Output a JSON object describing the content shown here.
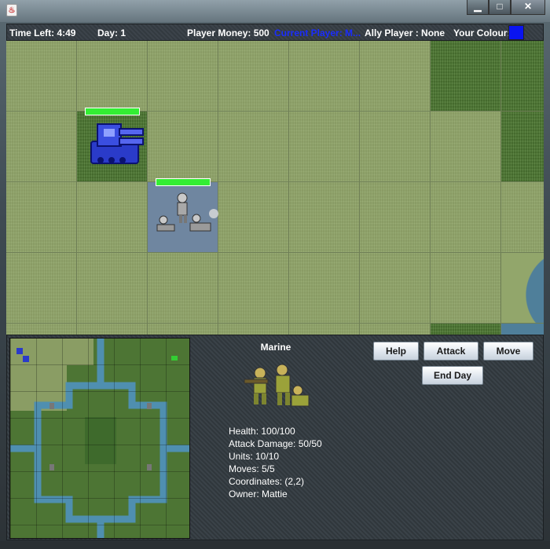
{
  "window": {
    "app_icon": "java-icon",
    "minimize_symbol": "▁",
    "maximize_symbol": "□",
    "close_symbol": "✕"
  },
  "status": {
    "time_left": "Time Left: 4:49",
    "day": "Day: 1",
    "player_money": "Player Money: 500",
    "current_player": "Current Player: M...",
    "ally_player": "Ally Player : None",
    "your_colour_label": "Your Colour:",
    "your_colour": "#0a14f0",
    "current_player_color": "#1a2cff"
  },
  "unit": {
    "name": "Marine",
    "stats": [
      "Health: 100/100",
      "Attack Damage: 50/50",
      "Units: 10/10",
      "Moves: 5/5",
      "Coordinates: (2,2)",
      "Owner: Mattie"
    ]
  },
  "buttons": {
    "help": "Help",
    "attack": "Attack",
    "move": "Move",
    "end_day": "End Day"
  },
  "map_units": [
    {
      "type": "tank-icon",
      "owner_color": "#2233cc",
      "health": 1.0
    },
    {
      "type": "marine-squad-icon",
      "owner_color": "#2233cc",
      "health": 1.0
    }
  ]
}
